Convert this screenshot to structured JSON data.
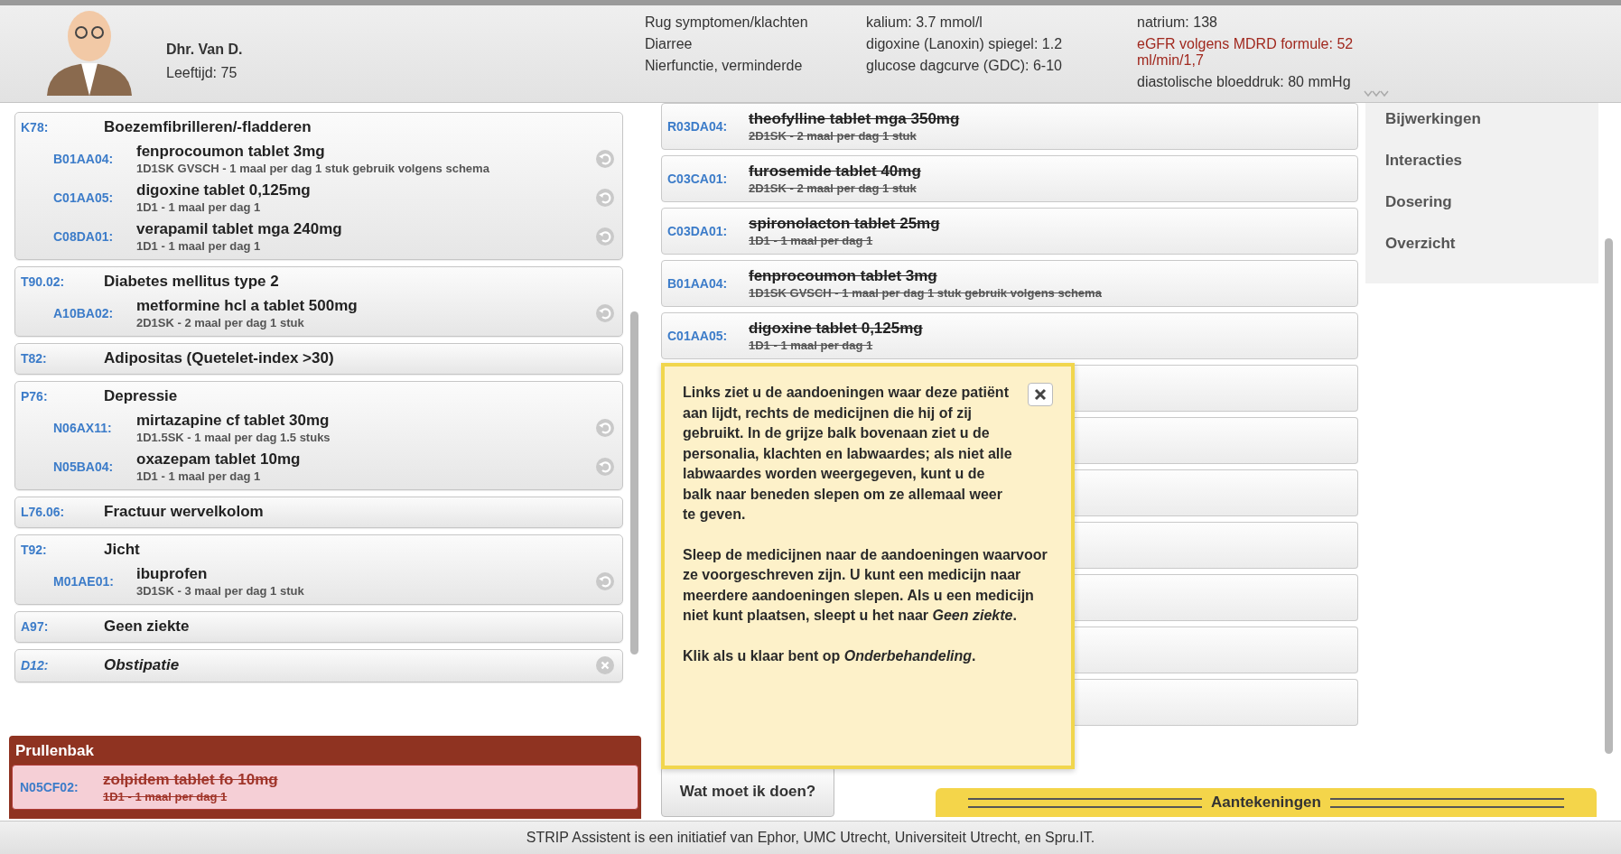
{
  "patient": {
    "name": "Dhr. Van D.",
    "age": "Leeftijd: 75"
  },
  "complaints": [
    "Rug symptomen/klachten",
    "Diarree",
    "Nierfunctie, verminderde"
  ],
  "lab_columns": [
    {
      "items": [
        {
          "text": "kalium: 3.7 mmol/l",
          "alert": false
        },
        {
          "text": "digoxine (Lanoxin) spiegel: 1.2",
          "alert": false
        },
        {
          "text": "glucose dagcurve (GDC): 6-10",
          "alert": false
        }
      ]
    },
    {
      "items": [
        {
          "text": "natrium: 138",
          "alert": false
        },
        {
          "text": "eGFR volgens MDRD formule: 52 ml/min/1,7",
          "alert": true
        },
        {
          "text": "diastolische bloeddruk: 80 mmHg",
          "alert": false
        }
      ]
    }
  ],
  "conditions": [
    {
      "code": "K78:",
      "name": "Boezemfibrilleren/-fladderen",
      "user_added": false,
      "medications": [
        {
          "code": "B01AA04:",
          "name": "fenprocoumon tablet 3mg",
          "dosage": "1D1SK GVSCH - 1 maal per dag 1 stuk gebruik volgens schema"
        },
        {
          "code": "C01AA05:",
          "name": "digoxine tablet 0,125mg",
          "dosage": "1D1 - 1 maal per dag 1"
        },
        {
          "code": "C08DA01:",
          "name": "verapamil tablet mga 240mg",
          "dosage": "1D1 - 1 maal per dag 1"
        }
      ]
    },
    {
      "code": "T90.02:",
      "name": "Diabetes mellitus type 2",
      "user_added": false,
      "medications": [
        {
          "code": "A10BA02:",
          "name": "metformine hcl a tablet 500mg",
          "dosage": "2D1SK - 2 maal per dag 1 stuk"
        }
      ]
    },
    {
      "code": "T82:",
      "name": "Adipositas (Quetelet-index >30)",
      "user_added": false
    },
    {
      "code": "P76:",
      "name": "Depressie",
      "user_added": false,
      "medications": [
        {
          "code": "N06AX11:",
          "name": "mirtazapine cf tablet 30mg",
          "dosage": "1D1.5SK - 1 maal per dag 1.5 stuks"
        },
        {
          "code": "N05BA04:",
          "name": "oxazepam tablet 10mg",
          "dosage": "1D1 - 1 maal per dag 1"
        }
      ]
    },
    {
      "code": "L76.06:",
      "name": "Fractuur wervelkolom",
      "user_added": false
    },
    {
      "code": "T92:",
      "name": "Jicht",
      "user_added": false,
      "medications": [
        {
          "code": "M01AE01:",
          "name": "ibuprofen",
          "dosage": "3D1SK - 3 maal per dag 1 stuk"
        }
      ]
    },
    {
      "code": "A97:",
      "name": "Geen ziekte",
      "user_added": false
    },
    {
      "code": "D12:",
      "name": "Obstipatie",
      "user_added": true
    }
  ],
  "trash": {
    "title": "Prullenbak",
    "medications": [
      {
        "code": "N05CF02:",
        "name": "zolpidem tablet fo 10mg",
        "dosage": "1D1 - 1 maal per dag 1",
        "crossed_out": true
      }
    ]
  },
  "unassigned": [
    {
      "kind": "medication",
      "code": "R03DA04:",
      "name": "theofylline tablet mga 350mg",
      "dosage": "2D1SK - 2 maal per dag 1 stuk",
      "crossed_out": true
    },
    {
      "kind": "medication",
      "code": "C03CA01:",
      "name": "furosemide tablet 40mg",
      "dosage": "2D1SK - 2 maal per dag 1 stuk",
      "crossed_out": true
    },
    {
      "kind": "medication",
      "code": "C03DA01:",
      "name": "spironolacton tablet 25mg",
      "dosage": "1D1 - 1 maal per dag 1",
      "crossed_out": true
    },
    {
      "kind": "medication",
      "code": "B01AA04:",
      "name": "fenprocoumon tablet 3mg",
      "dosage": "1D1SK GVSCH - 1 maal per dag 1 stuk gebruik volgens schema",
      "crossed_out": true
    },
    {
      "kind": "medication",
      "code": "C01AA05:",
      "name": "digoxine tablet 0,125mg",
      "dosage": "1D1 - 1 maal per dag 1",
      "crossed_out": true
    },
    {
      "kind": "empty"
    },
    {
      "kind": "empty"
    },
    {
      "kind": "empty"
    },
    {
      "kind": "empty"
    },
    {
      "kind": "empty"
    },
    {
      "kind": "empty"
    },
    {
      "kind": "empty"
    }
  ],
  "sidebar": {
    "items": [
      "Bijwerkingen",
      "Interacties",
      "Dosering",
      "Overzicht"
    ]
  },
  "help_popup": {
    "paragraphs": [
      "Links ziet u de aandoeningen waar deze patiënt aan lijdt, rechts de medicijnen die hij of zij gebruikt. In de grijze balk bovenaan ziet u de personalia, klachten en labwaardes; als niet alle labwaardes worden weergegeven, kunt u de balk naar beneden slepen om ze allemaal weer te geven.",
      "Sleep de medicijnen naar de aandoeningen waarvoor ze voorgeschreven zijn. U kunt een medicijn naar meerdere aandoeningen slepen. Als u een medicijn niet kunt plaatsen, sleept u het naar *Geen ziekte*.",
      "Klik als u klaar bent op *Onderbehandeling*."
    ]
  },
  "help_button": "Wat moet ik doen?",
  "notes_tab": "Aantekeningen",
  "footer": "STRIP Assistent is een initiatief van Ephor, UMC Utrecht, Universiteit Utrecht, en Spru.IT."
}
